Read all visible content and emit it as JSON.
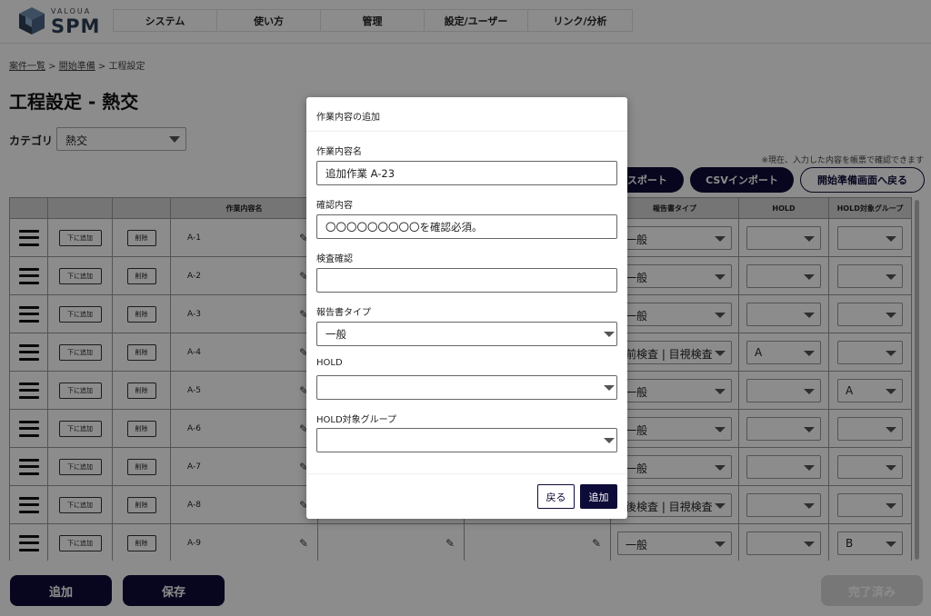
{
  "brand": {
    "top": "VALOUA",
    "name": "SPM"
  },
  "nav": [
    "システム",
    "使い方",
    "管理",
    "設定/ユーザー",
    "リンク/分析"
  ],
  "breadcrumb": {
    "item1": "案件一覧",
    "sep1": " > ",
    "item2": "開始準備",
    "sep2": " > ",
    "current": "工程設定"
  },
  "title": "工程設定 - 熱交",
  "category": {
    "label": "カテゴリ",
    "value": "熱交"
  },
  "notice": "※現在、入力した内容を帳票で確認できます",
  "buttons": {
    "export": "エクスポート",
    "csv_import": "CSVインポート",
    "back_to_prep": "開始準備画面へ戻る"
  },
  "table": {
    "headers": [
      "",
      "",
      "",
      "作業内容名",
      "",
      "",
      "報告書タイプ",
      "HOLD",
      "HOLD対象グループ"
    ],
    "add_below": "下に追加",
    "delete": "削除",
    "rows": [
      {
        "name": "A-1",
        "report": "一般",
        "hold": "",
        "group": ""
      },
      {
        "name": "A-2",
        "report": "一般",
        "hold": "",
        "group": ""
      },
      {
        "name": "A-3",
        "report": "一般",
        "hold": "",
        "group": ""
      },
      {
        "name": "A-4",
        "report": "前検査 | 目視検査",
        "hold": "A",
        "group": ""
      },
      {
        "name": "A-5",
        "report": "一般",
        "hold": "",
        "group": "A"
      },
      {
        "name": "A-6",
        "report": "一般",
        "hold": "",
        "group": ""
      },
      {
        "name": "A-7",
        "report": "一般",
        "hold": "",
        "group": ""
      },
      {
        "name": "A-8",
        "report": "後検査 | 目視検査",
        "hold": "",
        "group": ""
      },
      {
        "name": "A-9",
        "report": "一般",
        "hold": "",
        "group": "B"
      }
    ]
  },
  "footer": {
    "add": "追加",
    "save": "保存",
    "done": "完了済み"
  },
  "modal": {
    "title": "作業内容の追加",
    "name_label": "作業内容名",
    "name_value": "追加作業 A-23",
    "confirm_label": "確認内容",
    "confirm_value": "〇〇〇〇〇〇〇〇〇を確認必須。",
    "inspect_label": "検査確認",
    "inspect_value": "",
    "report_label": "報告書タイプ",
    "report_value": "一般",
    "hold_label": "HOLD",
    "hold_value": "",
    "group_label": "HOLD対象グループ",
    "group_value": "",
    "back": "戻る",
    "add": "追加"
  }
}
